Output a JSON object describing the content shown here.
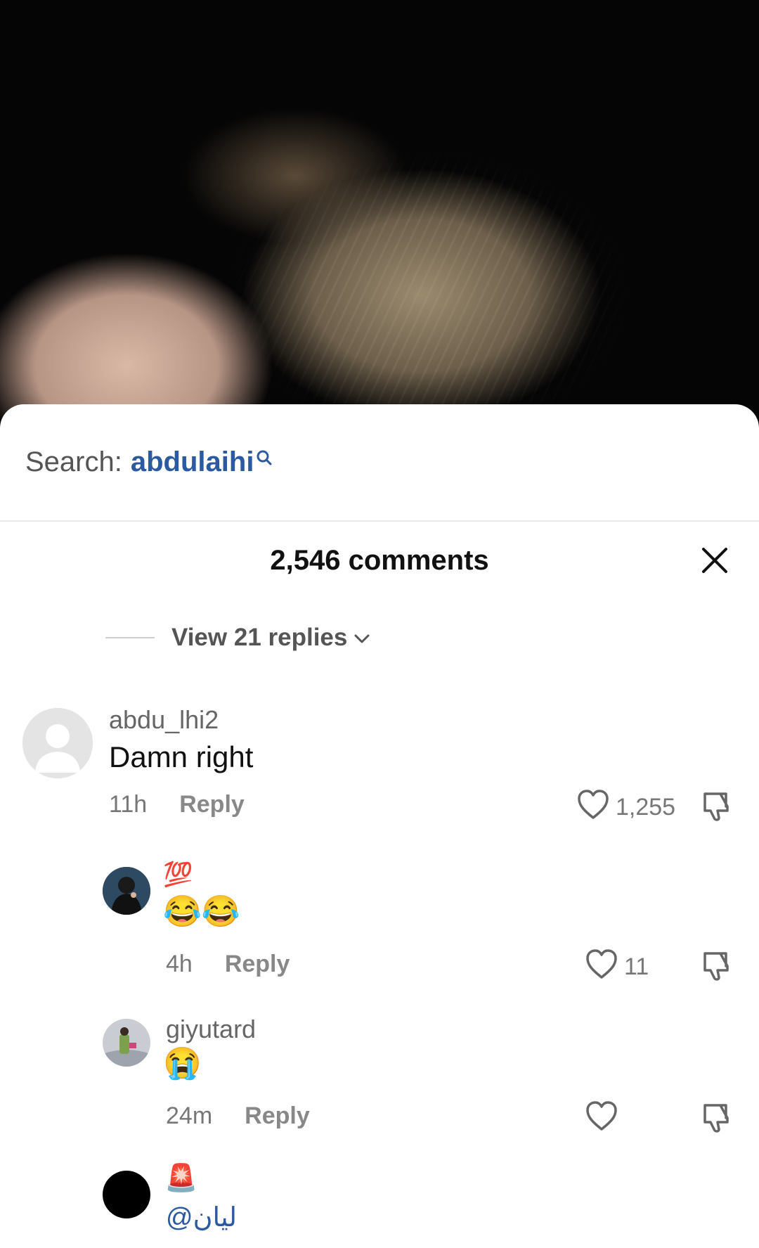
{
  "search": {
    "prefix": "Search:",
    "keyword": "abdulaihi"
  },
  "header": {
    "title": "2,546 comments"
  },
  "view_replies": {
    "label": "View 21 replies"
  },
  "comments": [
    {
      "username": "abdu_lhi2",
      "text": "Damn right",
      "time": "11h",
      "reply": "Reply",
      "likes": "1,255"
    },
    {
      "username": "",
      "badge": "💯",
      "text": "😂😂",
      "time": "4h",
      "reply": "Reply",
      "likes": "11"
    },
    {
      "username": "giyutard",
      "text": "😭",
      "time": "24m",
      "reply": "Reply",
      "likes": ""
    },
    {
      "username": "",
      "badge": "🚨",
      "text": "@ليان",
      "time": "",
      "reply": "",
      "likes": ""
    }
  ],
  "colors": {
    "accent_link": "#2c5aa0",
    "sheet_bg": "#ffffff",
    "muted": "#777777"
  }
}
